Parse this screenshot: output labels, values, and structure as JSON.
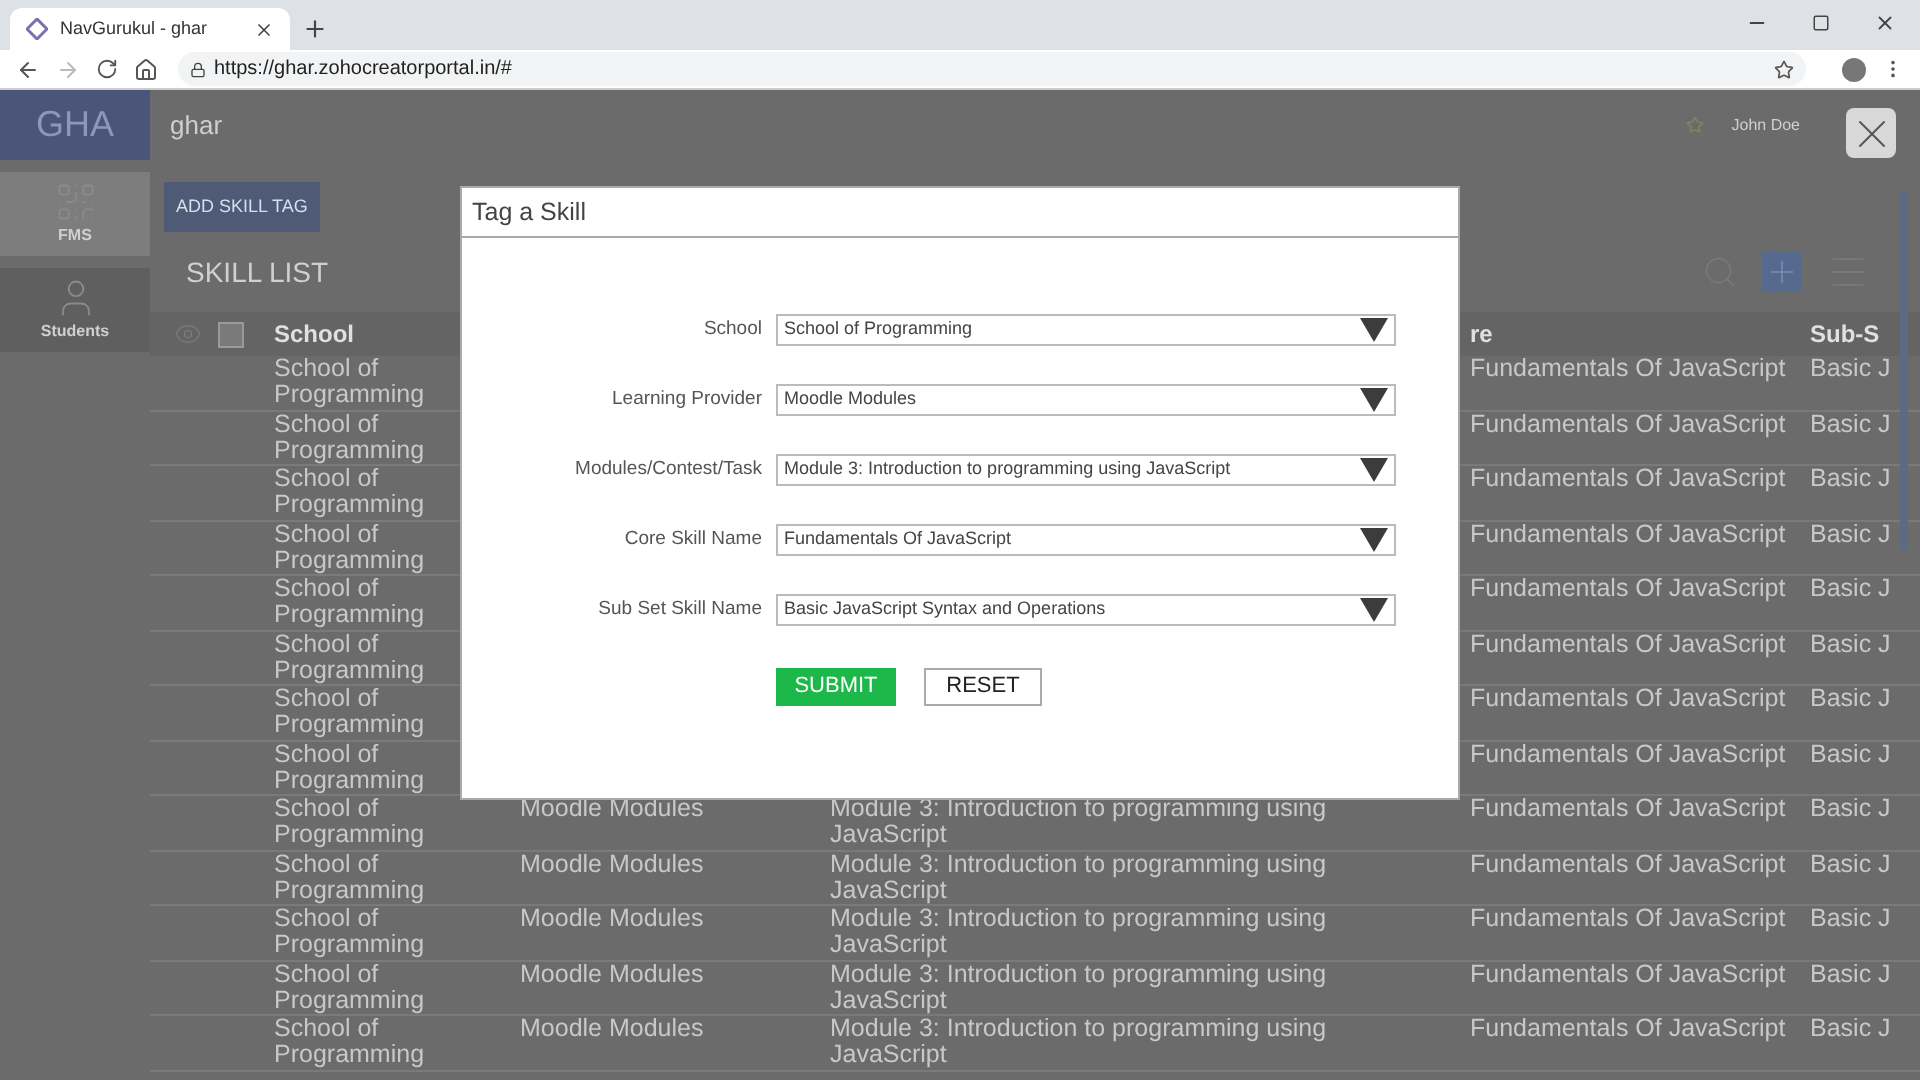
{
  "browser": {
    "tab_title": "NavGurukul - ghar",
    "url": "https://ghar.zohocreatorportal.in/#"
  },
  "app": {
    "logo": "GHA",
    "name": "ghar",
    "user": "John Doe"
  },
  "sidebar": {
    "items": [
      {
        "label": "FMS",
        "kind": "grid",
        "selected": true
      },
      {
        "label": "Students",
        "kind": "person",
        "selected": false
      }
    ]
  },
  "toolbar": {
    "add_button": "ADD SKILL TAG",
    "list_title": "SKILL LIST"
  },
  "table": {
    "select_all": {
      "checked": false
    },
    "header": {
      "school": "School",
      "column_4": "re",
      "column_5": "Sub-S"
    },
    "rows": [
      {
        "school": "School of Programming",
        "core": "Fundamentals Of JavaScript",
        "sub": "Basic J"
      },
      {
        "school": "School of Programming",
        "core": "Fundamentals Of JavaScript",
        "sub": "Basic J"
      },
      {
        "school": "School of Programming",
        "core": "Fundamentals Of JavaScript",
        "sub": "Basic J"
      },
      {
        "school": "School of Programming",
        "core": "Fundamentals Of JavaScript",
        "sub": "Basic J"
      },
      {
        "school": "School of Programming",
        "core": "Fundamentals Of JavaScript",
        "sub": "Basic J"
      },
      {
        "school": "School of Programming",
        "core": "Fundamentals Of JavaScript",
        "sub": "Basic J"
      },
      {
        "school": "School of Programming",
        "core": "Fundamentals Of JavaScript",
        "sub": "Basic J"
      },
      {
        "school": "School of Programming",
        "core": "Fundamentals Of JavaScript",
        "sub": "Basic J"
      },
      {
        "school": "School of Programming",
        "provider": "Moodle Modules",
        "module": "Module 3: Introduction to programming using JavaScript",
        "core": "Fundamentals Of JavaScript",
        "sub": "Basic J"
      },
      {
        "school": "School of Programming",
        "provider": "Moodle Modules",
        "module": "Module 3: Introduction to programming using JavaScript",
        "core": "Fundamentals Of JavaScript",
        "sub": "Basic J"
      },
      {
        "school": "School of Programming",
        "provider": "Moodle Modules",
        "module": "Module 3: Introduction to programming using JavaScript",
        "core": "Fundamentals Of JavaScript",
        "sub": "Basic J"
      },
      {
        "school": "School of Programming",
        "provider": "Moodle Modules",
        "module": "Module 3: Introduction to programming using JavaScript",
        "core": "Fundamentals Of JavaScript",
        "sub": "Basic J"
      },
      {
        "school": "School of Programming",
        "provider": "Moodle Modules",
        "module": "Module 3: Introduction to programming using JavaScript",
        "core": "Fundamentals Of JavaScript",
        "sub": "Basic J"
      }
    ]
  },
  "modal": {
    "title": "Tag a Skill",
    "fields": [
      {
        "label": "School",
        "value": "School of Programming"
      },
      {
        "label": "Learning Provider",
        "value": "Moodle Modules"
      },
      {
        "label": "Modules/Contest/Task",
        "value": "Module 3: Introduction to programming using JavaScript"
      },
      {
        "label": "Core Skill Name",
        "value": "Fundamentals Of JavaScript"
      },
      {
        "label": "Sub Set Skill Name",
        "value": "Basic JavaScript Syntax and Operations"
      }
    ],
    "submit": "SUBMIT",
    "reset": "RESET"
  }
}
